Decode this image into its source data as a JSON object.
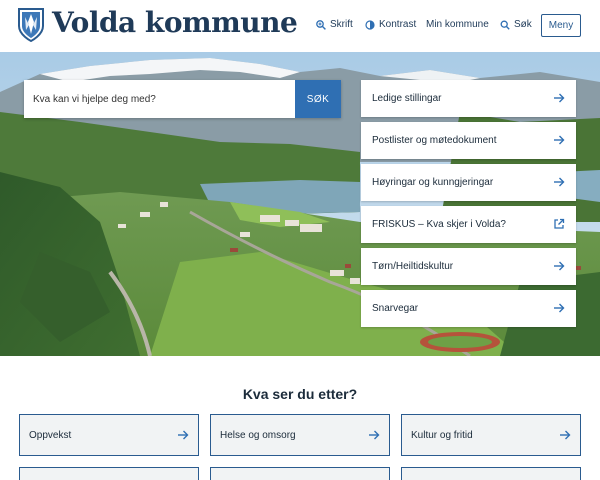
{
  "header": {
    "site_name": "Volda kommune",
    "tools": [
      {
        "label": "Skrift",
        "icon": "zoom-icon"
      },
      {
        "label": "Kontrast",
        "icon": "contrast-icon"
      },
      {
        "label": "Min kommune",
        "icon": ""
      },
      {
        "label": "Søk",
        "icon": "search-icon"
      }
    ],
    "menu_label": "Meny"
  },
  "search": {
    "placeholder": "Kva kan vi hjelpe deg med?",
    "button_label": "SØK"
  },
  "quicklinks": [
    {
      "label": "Ledige stillingar",
      "icon": "arrow-right-icon"
    },
    {
      "label": "Postlister og møtedokument",
      "icon": "arrow-right-icon"
    },
    {
      "label": "Høyringar og kunngjeringar",
      "icon": "arrow-right-icon"
    },
    {
      "label": "FRISKUS – Kva skjer i Volda?",
      "icon": "external-link-icon"
    },
    {
      "label": "Tørn/Heiltidskultur",
      "icon": "arrow-right-icon"
    },
    {
      "label": "Snarvegar",
      "icon": "arrow-right-icon"
    }
  ],
  "section": {
    "title": "Kva ser du etter?",
    "cards": [
      {
        "label": "Oppvekst"
      },
      {
        "label": "Helse og omsorg"
      },
      {
        "label": "Kultur og fritid"
      }
    ]
  },
  "colors": {
    "brand_navy": "#1f3a58",
    "accent_blue": "#2f6fb3",
    "card_border": "#2a5b8f"
  }
}
